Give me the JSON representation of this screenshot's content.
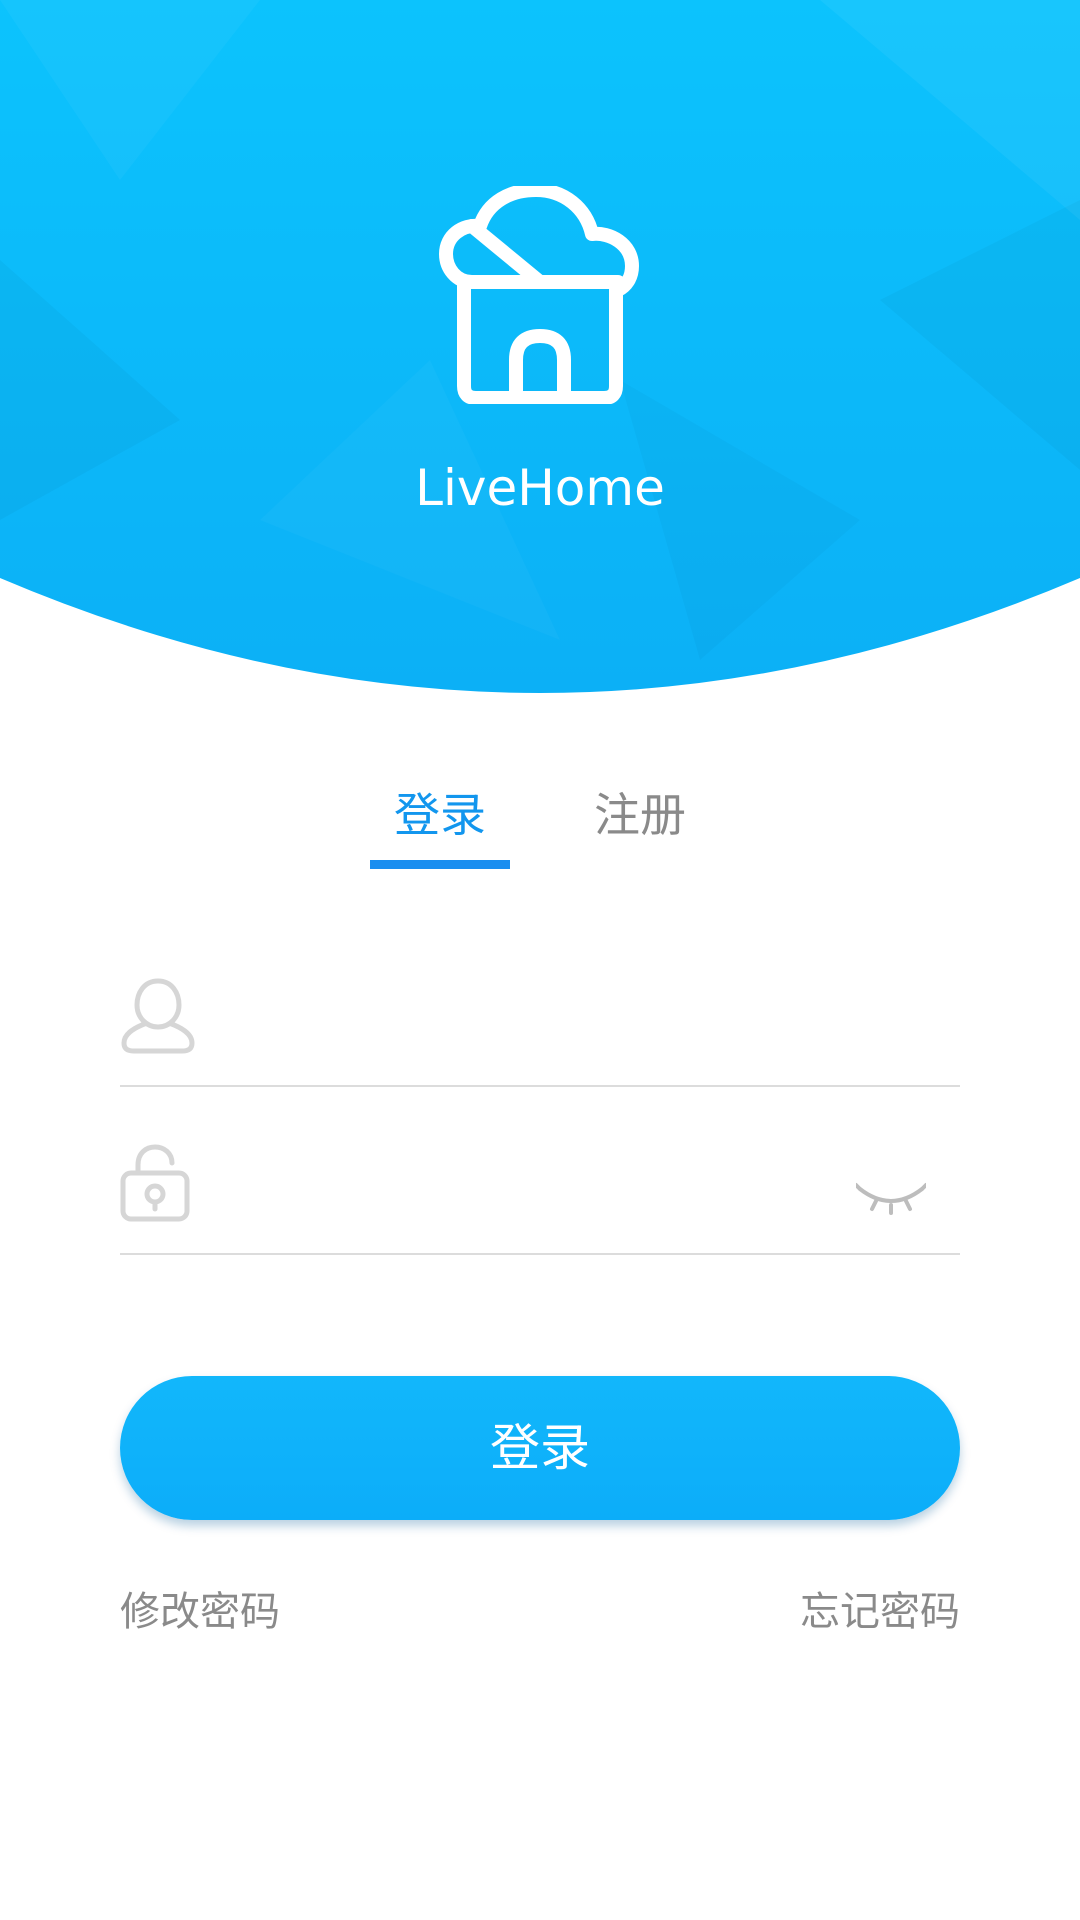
{
  "app": {
    "name": "LiveHome"
  },
  "tabs": [
    {
      "label": "登录",
      "active": true
    },
    {
      "label": "注册",
      "active": false
    }
  ],
  "form": {
    "username": {
      "value": "",
      "placeholder": "",
      "icon": "user-icon"
    },
    "password": {
      "value": "",
      "placeholder": "",
      "icon": "lock-icon",
      "toggle_icon": "eye-closed-icon"
    }
  },
  "login_button": {
    "label": "登录"
  },
  "links": {
    "change_password": "修改密码",
    "forgot_password": "忘记密码"
  },
  "colors": {
    "header_bg": "#0eb8fb",
    "accent": "#1296ee",
    "button_bg": "#0db0fa",
    "muted_text": "#8a8a8a",
    "divider": "#dcdcdc"
  }
}
